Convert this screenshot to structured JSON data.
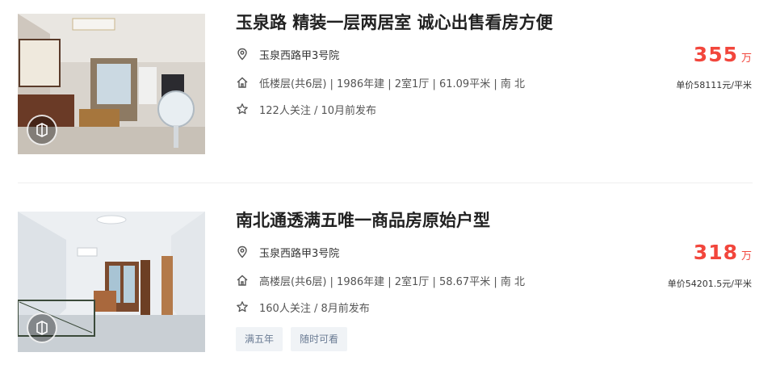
{
  "listings": [
    {
      "title": "玉泉路 精装一层两居室 诚心出售看房方便",
      "address": "玉泉西路甲3号院",
      "house_info": "低楼层(共6层) | 1986年建 | 2室1厅 | 61.09平米 | 南 北",
      "follow_info": "122人关注 / 10月前发布",
      "total_price": "355",
      "total_price_unit": "万",
      "unit_price": "单价58111元/平米",
      "tags": [],
      "photo_icon": "vr-tour-icon"
    },
    {
      "title": "南北通透满五唯一商品房原始户型",
      "address": "玉泉西路甲3号院",
      "house_info": "高楼层(共6层) | 1986年建 | 2室1厅 | 58.67平米 | 南 北",
      "follow_info": "160人关注 / 8月前发布",
      "total_price": "318",
      "total_price_unit": "万",
      "unit_price": "单价54201.5元/平米",
      "tags": [
        "满五年",
        "随时可看"
      ],
      "photo_icon": "vr-tour-icon"
    }
  ],
  "icons": {
    "address": "location-pin-icon",
    "house": "house-icon",
    "follow": "star-icon"
  },
  "colors": {
    "price": "#f2463c",
    "tag_bg": "#f0f3f6",
    "tag_text": "#6b7c94"
  }
}
